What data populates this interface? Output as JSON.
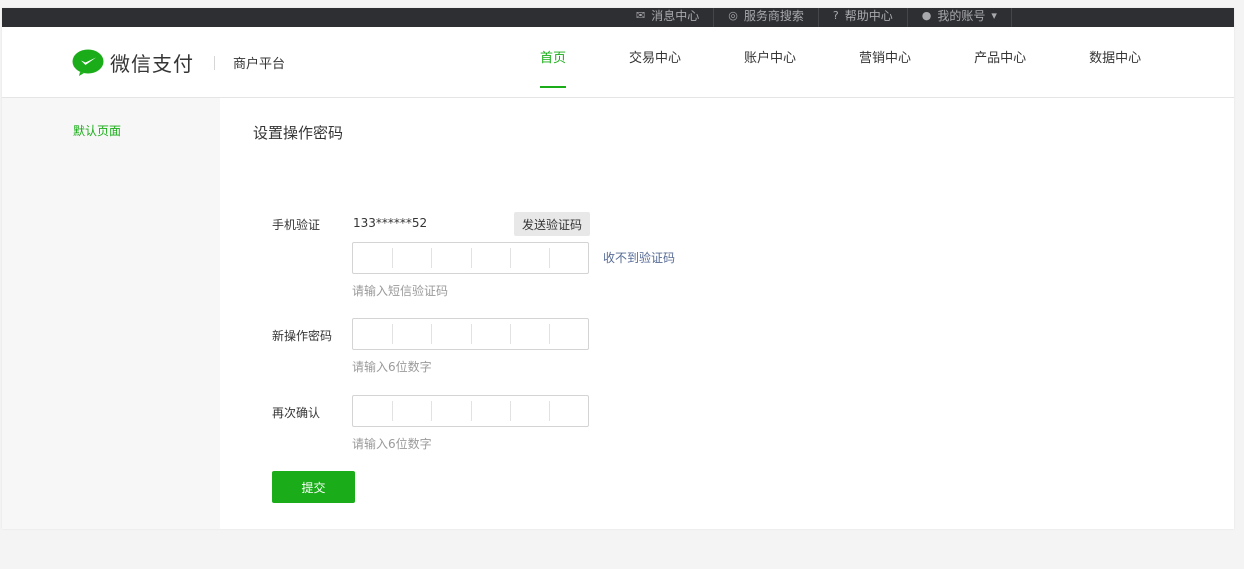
{
  "topbar": {
    "links": [
      {
        "label": "消息中心",
        "icon": "mail-icon"
      },
      {
        "label": "服务商搜索",
        "icon": "search-icon"
      },
      {
        "label": "帮助中心",
        "icon": "help-icon"
      },
      {
        "label": "我的账号",
        "icon": "user-icon"
      }
    ]
  },
  "header": {
    "logo_text": "微信支付",
    "logo_sub": "商户平台",
    "nav": [
      {
        "label": "首页",
        "active": true
      },
      {
        "label": "交易中心",
        "active": false
      },
      {
        "label": "账户中心",
        "active": false
      },
      {
        "label": "营销中心",
        "active": false
      },
      {
        "label": "产品中心",
        "active": false
      },
      {
        "label": "数据中心",
        "active": false
      }
    ]
  },
  "sidebar": {
    "items": [
      {
        "label": "默认页面"
      }
    ]
  },
  "main": {
    "title": "设置操作密码",
    "phone_label": "手机验证",
    "phone_number": "133******52",
    "send_code_label": "发送验证码",
    "no_code_link": "收不到验证码",
    "sms_hint": "请输入短信验证码",
    "new_password_label": "新操作密码",
    "new_password_hint": "请输入6位数字",
    "confirm_label": "再次确认",
    "confirm_hint": "请输入6位数字",
    "submit_label": "提交"
  },
  "colors": {
    "brand": "#1aad19",
    "topbar": "#2e2f33",
    "link": "#576b95"
  }
}
